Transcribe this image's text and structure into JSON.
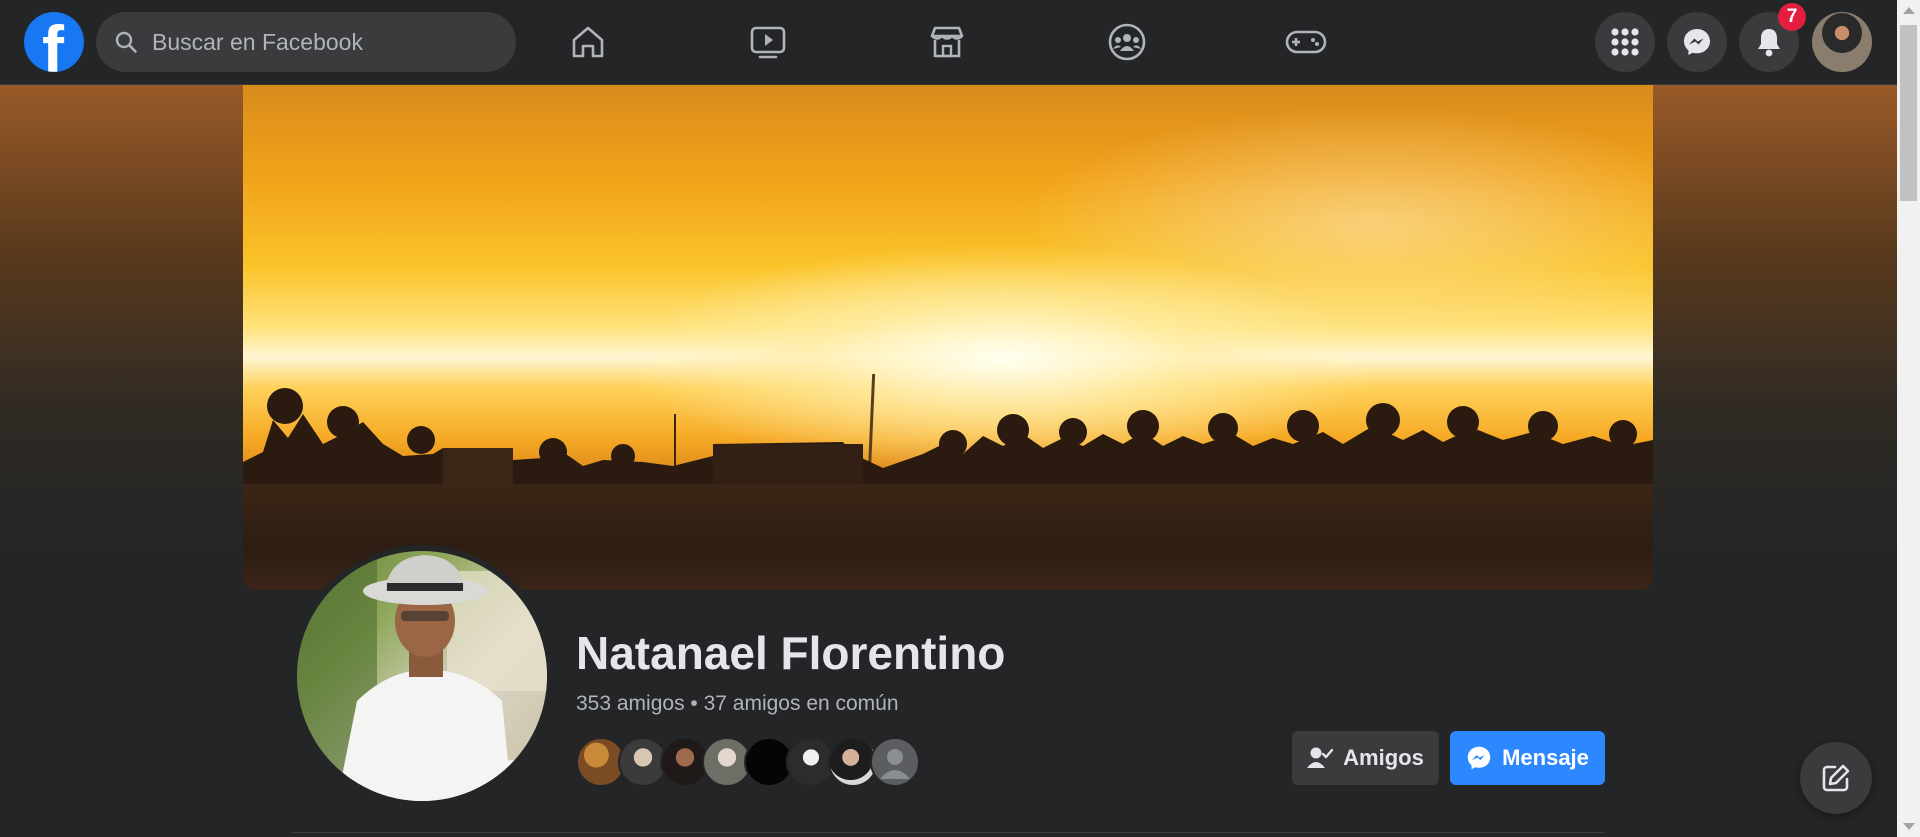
{
  "header": {
    "logo_letter": "f",
    "search": {
      "placeholder": "Buscar en Facebook"
    },
    "nav": [
      {
        "name": "home",
        "icon": "home-icon"
      },
      {
        "name": "watch",
        "icon": "video-icon"
      },
      {
        "name": "marketplace",
        "icon": "marketplace-icon"
      },
      {
        "name": "groups",
        "icon": "groups-icon"
      },
      {
        "name": "gaming",
        "icon": "gaming-icon"
      }
    ],
    "notifications_count": "7"
  },
  "profile": {
    "name": "Natanael Florentino",
    "stats": "353 amigos • 37 amigos en común",
    "friends_button": "Amigos",
    "message_button": "Mensaje"
  },
  "colors": {
    "brand": "#1877f2",
    "message_button": "#2d88ff",
    "badge": "#e41e3f",
    "background": "#242526"
  }
}
